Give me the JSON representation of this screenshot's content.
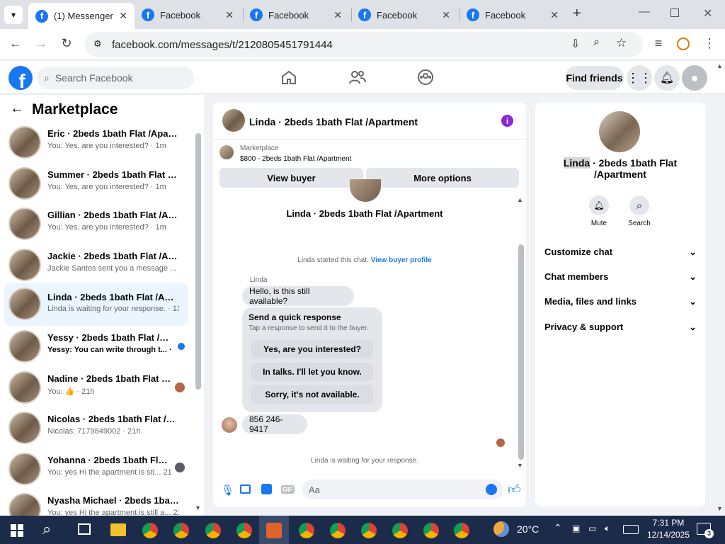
{
  "browser": {
    "tabs": [
      {
        "title": "(1) Messenger | Facebook"
      },
      {
        "title": "Facebook"
      },
      {
        "title": "Facebook"
      },
      {
        "title": "Facebook"
      },
      {
        "title": "Facebook"
      }
    ],
    "url": "facebook.com/messages/t/2120805451791444"
  },
  "fb": {
    "logo": "f",
    "search_placeholder": "Search Facebook",
    "find_friends": "Find friends"
  },
  "sidebar": {
    "title": "Marketplace",
    "conversations": [
      {
        "name": "Eric · 2beds 1bath Flat /Apartme...",
        "preview": "You: Yes, are you interested? · 1m"
      },
      {
        "name": "Summer · 2beds 1bath Flat /Apa...",
        "preview": "You: Yes, are you interested? · 1m"
      },
      {
        "name": "Gillian · 2beds 1bath Flat /Apart...",
        "preview": "You: Yes, are you interested? · 1m"
      },
      {
        "name": "Jackie · 2beds 1bath Flat /Apart...",
        "preview": "Jackie Santos sent you a message ... · 2h"
      },
      {
        "name": "Linda · 2beds 1bath Flat /Apart...",
        "preview": "Linda is waiting for your response. · 13h"
      },
      {
        "name": "Yessy · 2beds 1bath Flat /Apart...",
        "preview": "Yessy: You can write through t... · 20h"
      },
      {
        "name": "Nadine · 2beds 1bath Flat /Ap...",
        "preview": "You: 👍 · 21h"
      },
      {
        "name": "Nicolas · 2beds 1bath Flat /Apar...",
        "preview": "Nicolas: 7179849002 · 21h"
      },
      {
        "name": "Yohanna · 2beds 1bath Flat /A...",
        "preview": "You: yes Hi the apartment is sti... 21h"
      },
      {
        "name": "Nyasha Michael · 2beds 1bath Fl...",
        "preview": "You: yes Hi the apartment is still a... 21h"
      }
    ]
  },
  "chat": {
    "header_title": "Linda · 2beds 1bath Flat /Apartment",
    "listing_source": "Marketplace",
    "listing_price_title": "$800 - 2beds 1bath Flat /Apartment",
    "view_buyer": "View buyer",
    "more_options": "More options",
    "thread_title": "Linda · 2beds 1bath Flat /Apartment",
    "started_text": "Linda started this chat.",
    "view_buyer_profile": "View buyer profile",
    "sender_name": "Linda",
    "message1": "Hello, is this still available?",
    "quick_title": "Send a quick response",
    "quick_subtitle": "Tap a response to send it to the buyer.",
    "quick_responses": [
      "Yes, are you interested?",
      "In talks. I'll let you know.",
      "Sorry, it's not available."
    ],
    "message2": "856 246-9417",
    "waiting_text": "Linda is waiting for your response.",
    "input_placeholder": "Aa"
  },
  "details": {
    "name_highlight": "Linda",
    "name_rest": " · 2beds 1bath Flat /Apartment",
    "mute_label": "Mute",
    "search_label": "Search",
    "sections": [
      "Customize chat",
      "Chat members",
      "Media, files and links",
      "Privacy & support"
    ]
  },
  "taskbar": {
    "weather": "20°C",
    "time": "7:31 PM",
    "date": "12/14/2025",
    "notifications": "3"
  },
  "colors": {
    "fb_blue": "#1877f2",
    "purple": "#8e24d8",
    "taskbar": "#1c2b4a"
  }
}
